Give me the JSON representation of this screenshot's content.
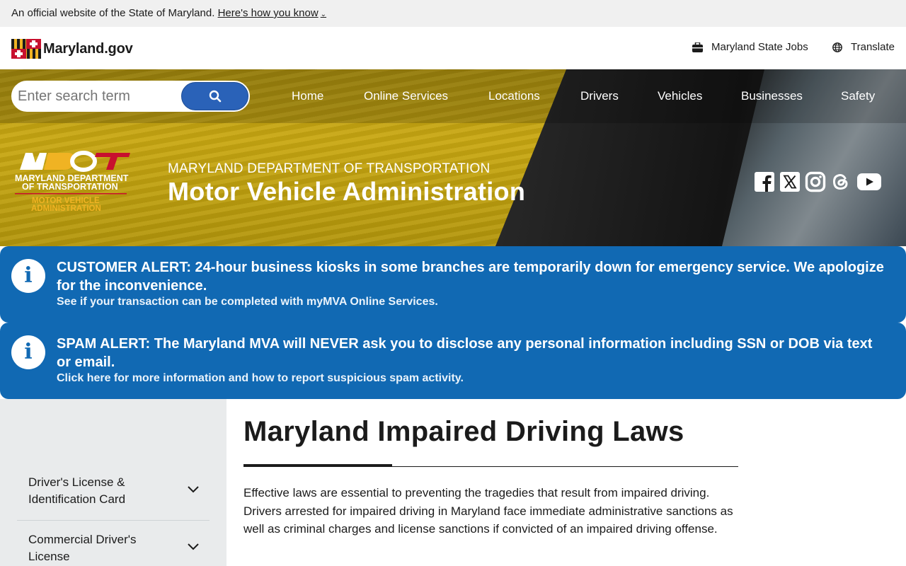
{
  "gov_banner": {
    "text": "An official website of the State of Maryland.",
    "link": "Here's how you know",
    "chevron_icon": "chevron-down"
  },
  "topbar": {
    "logo_text": "Maryland.gov",
    "jobs_link": "Maryland State Jobs",
    "jobs_icon": "briefcase-icon",
    "translate_link": "Translate",
    "translate_icon": "globe-icon"
  },
  "search": {
    "placeholder": "Enter search term",
    "value": "",
    "button_icon": "search-icon"
  },
  "nav": {
    "items": [
      "Home",
      "Online Services",
      "Locations",
      "Drivers",
      "Vehicles",
      "Businesses",
      "Safety"
    ]
  },
  "agency": {
    "logo_line1": "MARYLAND DEPARTMENT",
    "logo_line2": "OF TRANSPORTATION",
    "logo_line3": "MOTOR VEHICLE",
    "logo_line4": "ADMINISTRATION",
    "subtitle": "MARYLAND DEPARTMENT OF TRANSPORTATION",
    "title": "Motor Vehicle Administration"
  },
  "social": [
    "facebook-icon",
    "x-icon",
    "instagram-icon",
    "threads-icon",
    "youtube-icon"
  ],
  "alerts": [
    {
      "title": "CUSTOMER ALERT: 24-hour business kiosks in some branches are temporarily down for emergency service. We apologize for the inconvenience.",
      "link": "See if your transaction can be completed with myMVA Online Services."
    },
    {
      "title": "SPAM ALERT: The Maryland MVA will NEVER ask you to disclose any personal information including SSN or DOB via text or email.",
      "link": "Click here for more information and how to report suspicious spam activity."
    }
  ],
  "sidenav": {
    "items": [
      {
        "label": "Driver's License & Identification Card"
      },
      {
        "label": "Commercial Driver's License"
      }
    ]
  },
  "main": {
    "title": "Maryland Impaired Driving Laws",
    "intro": "Effective laws are essential to preventing the tragedies that result from impaired driving. Drivers arrested for impaired driving in Maryland face immediate administrative sanctions as well as criminal charges and license sanctions if convicted of an impaired driving offense."
  },
  "colors": {
    "alert_blue": "#1169b3",
    "search_button": "#2a62b8",
    "hero_gold": "#c9a812",
    "mdot_red": "#c8102e",
    "mdot_gold": "#f0b323"
  }
}
